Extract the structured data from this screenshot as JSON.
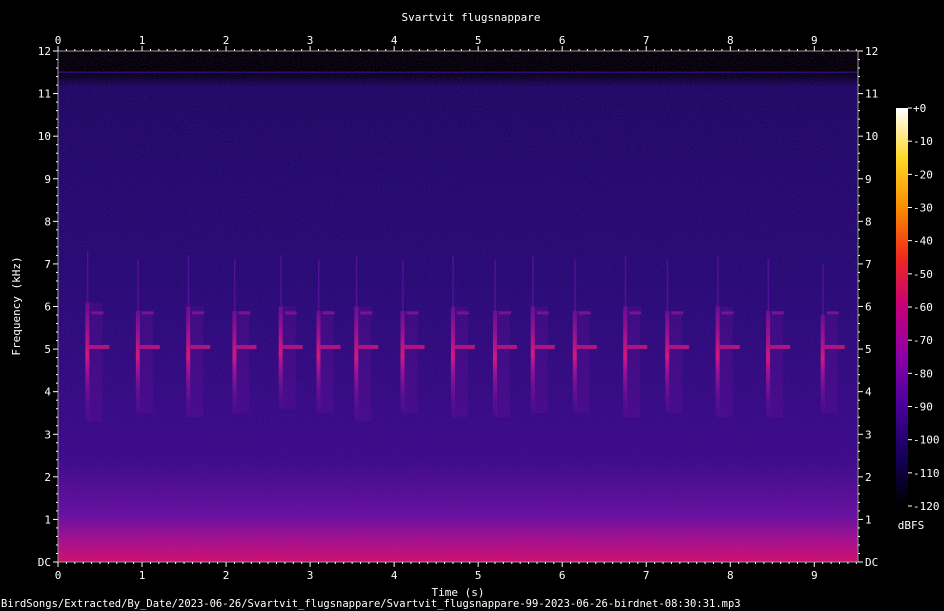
{
  "chart_data": {
    "type": "heatmap",
    "title": "Svartvit flugsnappare",
    "xlabel": "Time (s)",
    "ylabel": "Frequency (kHz)",
    "xlim": [
      0,
      9.52
    ],
    "ylim": [
      0,
      12
    ],
    "x_ticks": [
      "0",
      "1",
      "2",
      "3",
      "4",
      "5",
      "6",
      "7",
      "8",
      "9"
    ],
    "y_ticks": [
      "DC",
      "1",
      "2",
      "3",
      "4",
      "5",
      "6",
      "7",
      "8",
      "9",
      "10",
      "11",
      "12"
    ],
    "colorbar": {
      "label": "dBFS",
      "ticks": [
        "+0",
        "-10",
        "-20",
        "-30",
        "-40",
        "-50",
        "-60",
        "-70",
        "-80",
        "-90",
        "-100",
        "-110",
        "-120"
      ],
      "range": [
        -120,
        0
      ],
      "colors": [
        "#000000",
        "#14005a",
        "#48009a",
        "#8a00a8",
        "#c4007a",
        "#ee2a1e",
        "#fb8c00",
        "#ffd828",
        "#ffffff"
      ]
    },
    "noise_ceiling_khz": 11.5,
    "syllables": [
      {
        "t": 0.35,
        "fmin": 3.3,
        "fmax": 6.1
      },
      {
        "t": 0.95,
        "fmin": 3.5,
        "fmax": 5.9
      },
      {
        "t": 1.55,
        "fmin": 3.4,
        "fmax": 6.0
      },
      {
        "t": 2.1,
        "fmin": 3.5,
        "fmax": 5.9
      },
      {
        "t": 2.65,
        "fmin": 3.6,
        "fmax": 6.0
      },
      {
        "t": 3.1,
        "fmin": 3.5,
        "fmax": 5.9
      },
      {
        "t": 3.55,
        "fmin": 3.3,
        "fmax": 6.0
      },
      {
        "t": 4.1,
        "fmin": 3.5,
        "fmax": 5.9
      },
      {
        "t": 4.7,
        "fmin": 3.4,
        "fmax": 6.0
      },
      {
        "t": 5.2,
        "fmin": 3.4,
        "fmax": 5.9
      },
      {
        "t": 5.65,
        "fmin": 3.5,
        "fmax": 6.0
      },
      {
        "t": 6.15,
        "fmin": 3.5,
        "fmax": 5.9
      },
      {
        "t": 6.75,
        "fmin": 3.4,
        "fmax": 6.0
      },
      {
        "t": 7.25,
        "fmin": 3.5,
        "fmax": 5.9
      },
      {
        "t": 7.85,
        "fmin": 3.4,
        "fmax": 6.0
      },
      {
        "t": 8.45,
        "fmin": 3.4,
        "fmax": 5.9
      },
      {
        "t": 9.1,
        "fmin": 3.5,
        "fmax": 5.8
      }
    ],
    "footer_path": "BirdSongs/Extracted/By_Date/2023-06-26/Svartvit_flugsnappare/Svartvit_flugsnappare-99-2023-06-26-birdnet-08:30:31.mp3"
  }
}
